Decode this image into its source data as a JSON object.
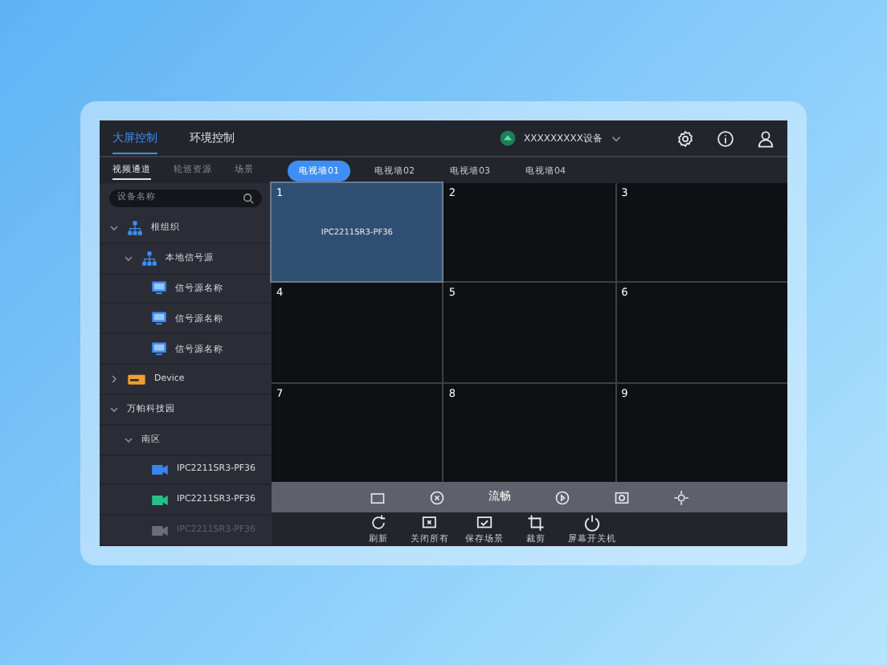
{
  "header": {
    "tabs": [
      {
        "label": "大屏控制",
        "selected": true
      },
      {
        "label": "环境控制",
        "selected": false
      }
    ],
    "device": {
      "name": "XXXXXXXXX设备"
    }
  },
  "sidebar": {
    "tabs": [
      {
        "label": "视频通道",
        "selected": true
      },
      {
        "label": "轮巡资源",
        "selected": false
      },
      {
        "label": "场景",
        "selected": false
      }
    ],
    "search": {
      "placeholder": "设备名称"
    },
    "tree": [
      {
        "label": "根组织",
        "kind": "group",
        "expanded": true,
        "children": [
          {
            "label": "本地信号源",
            "kind": "group",
            "expanded": true,
            "children": [
              {
                "label": "信号源名称",
                "kind": "screen"
              },
              {
                "label": "信号源名称",
                "kind": "screen"
              },
              {
                "label": "信号源名称",
                "kind": "screen"
              }
            ]
          }
        ]
      },
      {
        "label": "Device",
        "kind": "device",
        "expanded": false
      },
      {
        "label": "万帕科技园",
        "kind": "folder",
        "expanded": true,
        "children": [
          {
            "label": "南区",
            "kind": "folder",
            "expanded": true,
            "children": [
              {
                "label": "IPC2211SR3-PF36",
                "kind": "camera",
                "color": "#3a86f0",
                "disabled": false
              },
              {
                "label": "IPC2211SR3-PF36",
                "kind": "camera",
                "color": "#27c08a",
                "disabled": false
              },
              {
                "label": "IPC2211SR3-PF36",
                "kind": "camera",
                "color": "#6b6e76",
                "disabled": true
              }
            ]
          }
        ]
      }
    ]
  },
  "walls": [
    {
      "label": "电视墙01",
      "selected": true
    },
    {
      "label": "电视墙02",
      "selected": false
    },
    {
      "label": "电视墙03",
      "selected": false
    },
    {
      "label": "电视墙04",
      "selected": false
    }
  ],
  "grid": [
    {
      "number": "1",
      "source": "IPC2211SR3-PF36",
      "selected": true
    },
    {
      "number": "2",
      "selected": false
    },
    {
      "number": "3",
      "selected": false
    },
    {
      "number": "4",
      "selected": false
    },
    {
      "number": "5",
      "selected": false
    },
    {
      "number": "6",
      "selected": false
    },
    {
      "number": "7",
      "selected": false
    },
    {
      "number": "8",
      "selected": false
    },
    {
      "number": "9",
      "selected": false
    }
  ],
  "toolbar": [
    {
      "kind": "icon"
    },
    {
      "kind": "icon"
    },
    {
      "kind": "text",
      "label": "流畅"
    },
    {
      "kind": "icon"
    },
    {
      "kind": "icon"
    },
    {
      "kind": "icon"
    }
  ],
  "actions": [
    {
      "label": "刷新"
    },
    {
      "label": "关闭所有"
    },
    {
      "label": "保存场景"
    },
    {
      "label": "裁剪"
    },
    {
      "label": "屏幕开关机"
    }
  ]
}
